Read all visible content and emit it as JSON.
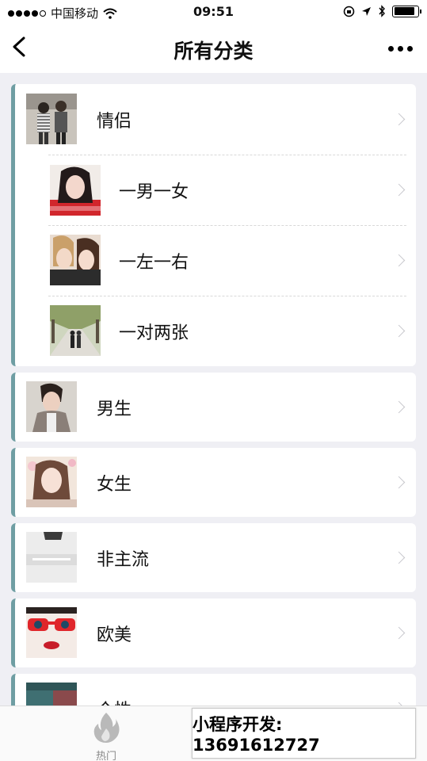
{
  "status_bar": {
    "carrier": "中国移动",
    "time": "09:51",
    "battery_level": 0.9
  },
  "navbar": {
    "title": "所有分类",
    "back_icon": "chevron-left-icon",
    "more_icon": "ellipsis-icon"
  },
  "categories": [
    {
      "label": "情侣",
      "sub": [
        {
          "label": "一男一女"
        },
        {
          "label": "一左一右"
        },
        {
          "label": "一对两张"
        }
      ]
    },
    {
      "label": "男生"
    },
    {
      "label": "女生"
    },
    {
      "label": "非主流"
    },
    {
      "label": "欧美"
    },
    {
      "label": "个性"
    }
  ],
  "tabbar": {
    "hot_label": "热门",
    "hot_icon": "flame-icon"
  },
  "promo": {
    "text": "小程序开发: 13691612727"
  },
  "colors": {
    "accent_bar": "#6f9ea3",
    "background": "#efeff4"
  }
}
